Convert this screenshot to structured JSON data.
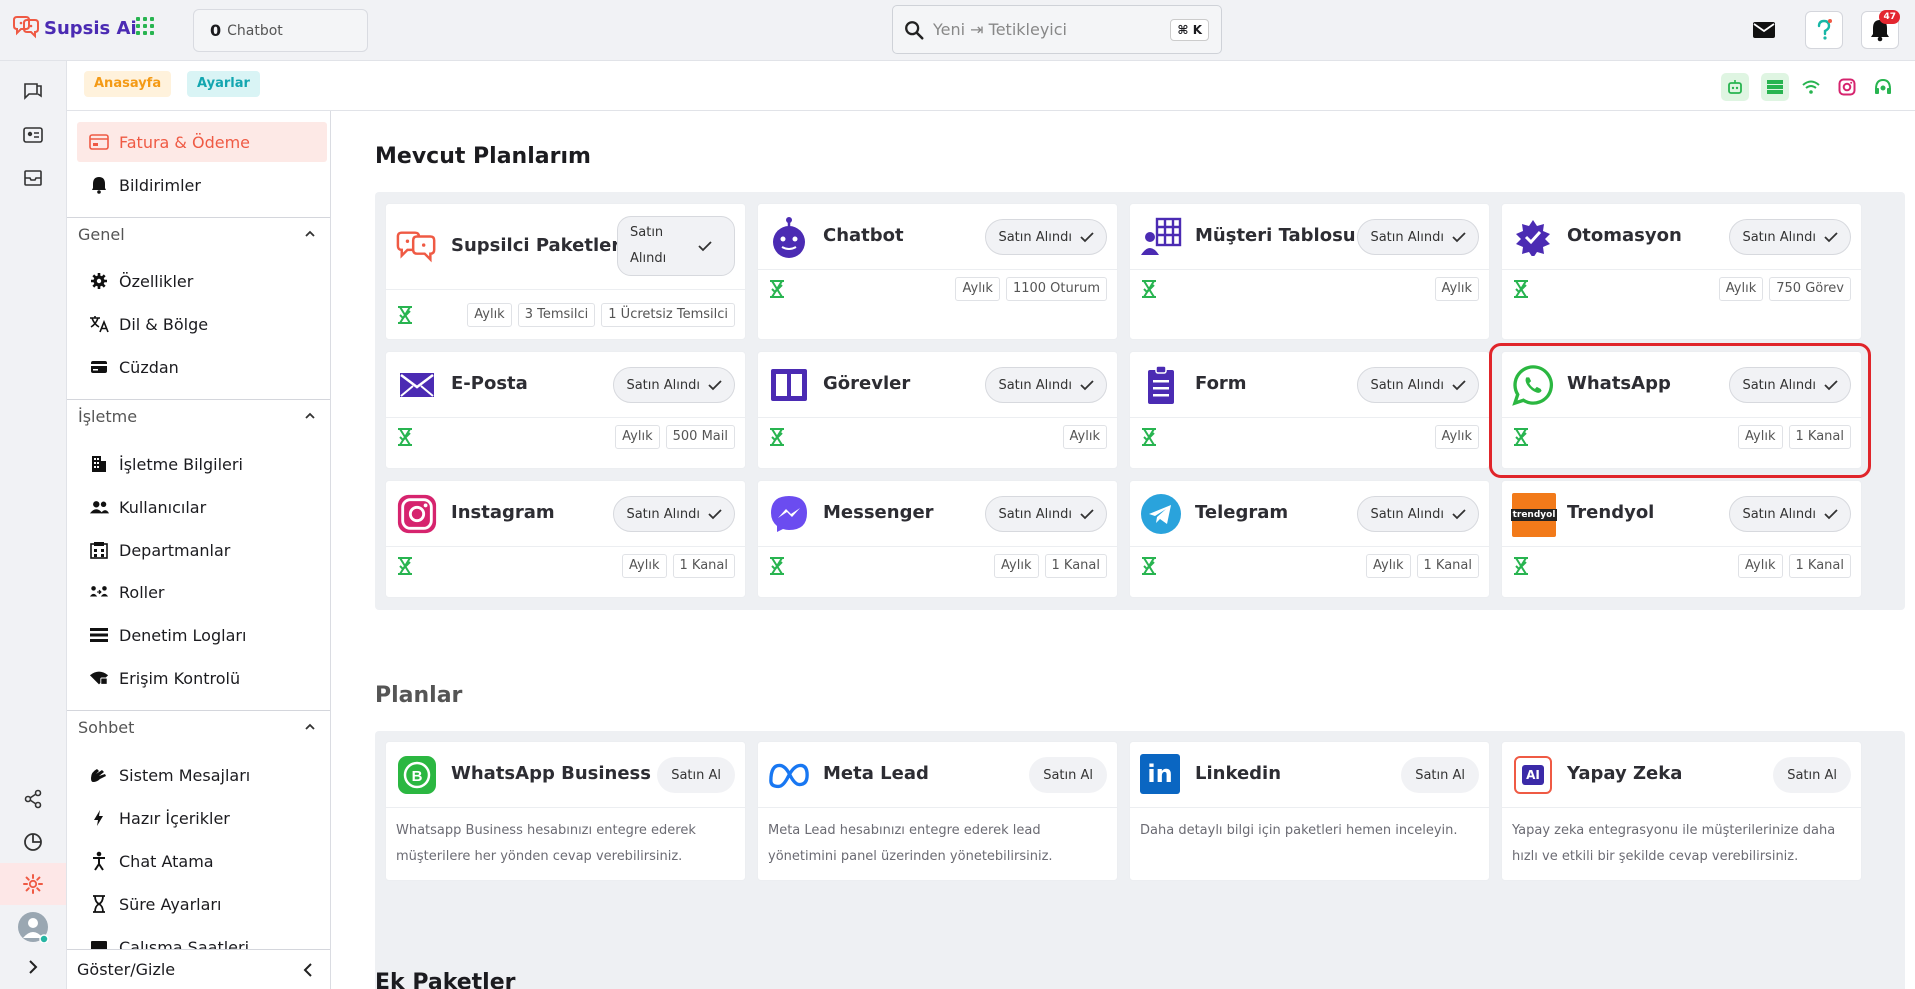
{
  "header": {
    "logo_text": "Supsis Ai",
    "chatbot_count": "0",
    "chatbot_label": "Chatbot",
    "search_placeholder": "Yeni ⇥ Tetikleyici",
    "search_shortcut": "⌘ K",
    "notification_count": "47"
  },
  "breadcrumb": {
    "home": "Anasayfa",
    "current": "Ayarlar"
  },
  "sidebar": {
    "top_items": [
      {
        "label": "Fatura & Ödeme",
        "icon": "invoice-icon"
      },
      {
        "label": "Bildirimler",
        "icon": "bell-icon"
      }
    ],
    "sections": [
      {
        "title": "Genel",
        "items": [
          {
            "label": "Özellikler",
            "icon": "gear-icon"
          },
          {
            "label": "Dil & Bölge",
            "icon": "translate-icon"
          },
          {
            "label": "Cüzdan",
            "icon": "wallet-icon"
          }
        ]
      },
      {
        "title": "İşletme",
        "items": [
          {
            "label": "İşletme Bilgileri",
            "icon": "building-icon"
          },
          {
            "label": "Kullanıcılar",
            "icon": "users-icon"
          },
          {
            "label": "Departmanlar",
            "icon": "department-icon"
          },
          {
            "label": "Roller",
            "icon": "roles-icon"
          },
          {
            "label": "Denetim Logları",
            "icon": "list-icon"
          },
          {
            "label": "Erişim Kontrolü",
            "icon": "access-icon"
          }
        ]
      },
      {
        "title": "Sohbet",
        "items": [
          {
            "label": "Sistem Mesajları",
            "icon": "hand-icon"
          },
          {
            "label": "Hazır İçerikler",
            "icon": "bolt-icon"
          },
          {
            "label": "Chat Atama",
            "icon": "person-icon"
          },
          {
            "label": "Süre Ayarları",
            "icon": "hourglass-icon"
          },
          {
            "label": "Çalışma Saatleri",
            "icon": "calendar-icon"
          }
        ]
      }
    ],
    "footer_label": "Göster/Gizle"
  },
  "main": {
    "my_plans_title": "Mevcut Planlarım",
    "plans_title": "Planlar",
    "extra_title": "Ek Paketler",
    "bought_label": "Satın Alındı",
    "my_plans": [
      {
        "name": "Supsilci Paketleri",
        "icon": "supsis-icon",
        "button": "Satın Alındı",
        "tags": [
          "Aylık",
          "3 Temsilci",
          "1 Ücretsiz Temsilci"
        ]
      },
      {
        "name": "Chatbot",
        "icon": "robot-icon",
        "button": "Satın Alındı",
        "tags": [
          "Aylık",
          "1100 Oturum"
        ]
      },
      {
        "name": "Müşteri Tablosu",
        "icon": "customer-table-icon",
        "button": "Satın Alındı",
        "tags": [
          "Aylık"
        ]
      },
      {
        "name": "Otomasyon",
        "icon": "automation-icon",
        "button": "Satın Alındı",
        "tags": [
          "Aylık",
          "750 Görev"
        ]
      },
      {
        "name": "E-Posta",
        "icon": "mail-icon",
        "button": "Satın Alındı",
        "tags": [
          "Aylık",
          "500 Mail"
        ]
      },
      {
        "name": "Görevler",
        "icon": "tasks-icon",
        "button": "Satın Alındı",
        "tags": [
          "Aylık"
        ]
      },
      {
        "name": "Form",
        "icon": "clipboard-icon",
        "button": "Satın Alındı",
        "tags": [
          "Aylık"
        ]
      },
      {
        "name": "WhatsApp",
        "icon": "whatsapp-icon",
        "button": "Satın Alındı",
        "tags": [
          "Aylık",
          "1 Kanal"
        ]
      },
      {
        "name": "Instagram",
        "icon": "instagram-icon",
        "button": "Satın Alındı",
        "tags": [
          "Aylık",
          "1 Kanal"
        ]
      },
      {
        "name": "Messenger",
        "icon": "messenger-icon",
        "button": "Satın Alındı",
        "tags": [
          "Aylık",
          "1 Kanal"
        ]
      },
      {
        "name": "Telegram",
        "icon": "telegram-icon",
        "button": "Satın Alındı",
        "tags": [
          "Aylık",
          "1 Kanal"
        ]
      },
      {
        "name": "Trendyol",
        "icon": "trendyol-icon",
        "logo_text": "trendyol",
        "button": "Satın Alındı",
        "tags": [
          "Aylık",
          "1 Kanal"
        ]
      }
    ],
    "plans": [
      {
        "name": "WhatsApp Business",
        "icon": "whatsapp-business-icon",
        "button": "Satın Al",
        "description": "Whatsapp Business hesabınızı entegre ederek müşterilere her yönden cevap verebilirsiniz."
      },
      {
        "name": "Meta Lead",
        "icon": "meta-icon",
        "button": "Satın Al",
        "description": "Meta Lead hesabınızı entegre ederek lead yönetimini panel üzerinden yönetebilirsiniz."
      },
      {
        "name": "Linkedin",
        "icon": "linkedin-icon",
        "logo_text": "in",
        "button": "Satın Al",
        "description": "Daha detaylı bilgi için paketleri hemen inceleyin."
      },
      {
        "name": "Yapay Zeka",
        "icon": "ai-chip-icon",
        "logo_text": "AI",
        "button": "Satın Al",
        "description": "Yapay zeka entegrasyonu ile müşterilerinize daha hızlı ve etkili bir şekilde cevap verebilirsiniz."
      }
    ]
  },
  "colors": {
    "accent": "#ef5a44",
    "brand": "#4b2bb3",
    "green": "#28b450",
    "highlight": "#e0252a"
  }
}
